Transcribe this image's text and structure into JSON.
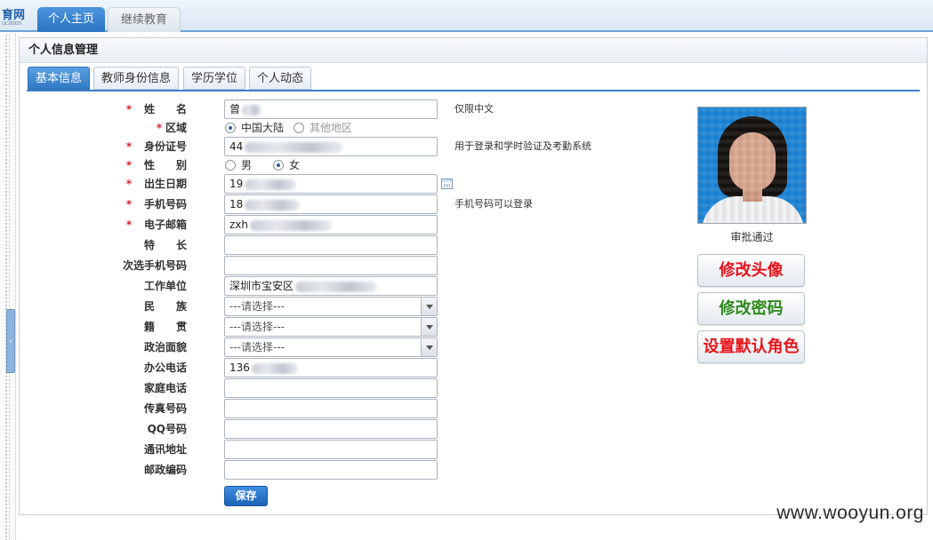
{
  "brand": {
    "logo_text": "育网",
    "logo_sub": "ucation"
  },
  "top_tabs": [
    {
      "label": "个人主页",
      "active": true
    },
    {
      "label": "继续教育",
      "active": false
    }
  ],
  "panel": {
    "title": "个人信息管理",
    "tabs": [
      {
        "label": "基本信息",
        "active": true
      },
      {
        "label": "教师身份信息",
        "active": false
      },
      {
        "label": "学历学位",
        "active": false
      },
      {
        "label": "个人动态",
        "active": false
      }
    ]
  },
  "form": {
    "name": {
      "label": "姓　　名",
      "required": true,
      "value": "曾",
      "hint": "仅限中文"
    },
    "region": {
      "label": "区域",
      "required": true,
      "options": [
        "中国大陆",
        "其他地区"
      ],
      "selected": "中国大陆"
    },
    "id_number": {
      "label": "身份证号",
      "required": true,
      "value": "44",
      "hint": "用于登录和学时验证及考勤系统"
    },
    "gender": {
      "label": "性　　别",
      "required": true,
      "options": [
        "男",
        "女"
      ],
      "selected": "女"
    },
    "birthdate": {
      "label": "出生日期",
      "required": true,
      "value": "19"
    },
    "mobile": {
      "label": "手机号码",
      "required": true,
      "value": "18",
      "hint": "手机号码可以登录"
    },
    "email": {
      "label": "电子邮箱",
      "required": true,
      "value": "zxh"
    },
    "specialty": {
      "label": "特　　长",
      "value": ""
    },
    "alt_mobile": {
      "label": "次选手机号码",
      "value": ""
    },
    "work_unit": {
      "label": "工作单位",
      "value": "深圳市宝安区"
    },
    "ethnicity": {
      "label": "民　　族",
      "value": "---请选择---"
    },
    "native_place": {
      "label": "籍　　贯",
      "value": "---请选择---"
    },
    "political_status": {
      "label": "政治面貌",
      "value": "---请选择---"
    },
    "office_phone": {
      "label": "办公电话",
      "value": "136"
    },
    "home_phone": {
      "label": "家庭电话",
      "value": ""
    },
    "fax": {
      "label": "传真号码",
      "value": ""
    },
    "qq": {
      "label": "QQ号码",
      "value": ""
    },
    "address": {
      "label": "通讯地址",
      "value": ""
    },
    "postcode": {
      "label": "邮政编码",
      "value": ""
    },
    "save_label": "保存"
  },
  "profile": {
    "status": "审批通过",
    "buttons": [
      {
        "label": "修改头像",
        "color": "#e8141c"
      },
      {
        "label": "修改密码",
        "color": "#2f8a1e"
      },
      {
        "label": "设置默认角色",
        "color": "#e8141c"
      }
    ]
  },
  "watermark": "www.wooyun.org"
}
